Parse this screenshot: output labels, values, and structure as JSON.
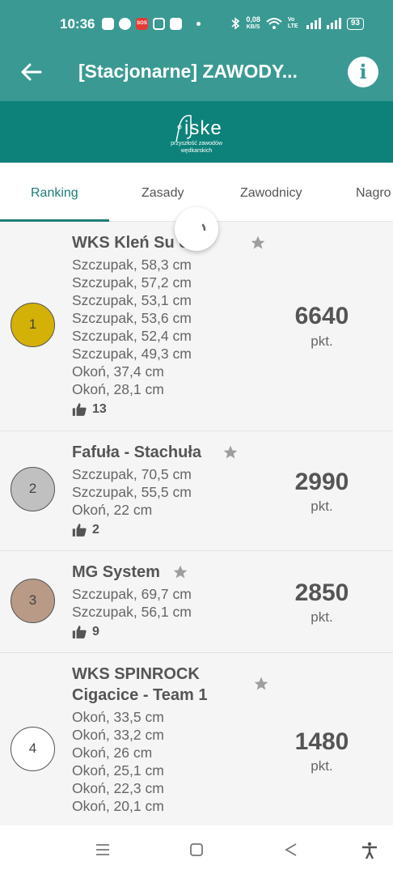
{
  "status_bar": {
    "time": "10:36",
    "net_speed_value": "0,08",
    "net_speed_unit": "KB/S",
    "volte": "Vo LTE",
    "battery": "93"
  },
  "header": {
    "title": "[Stacjonarne] ZAWODY..."
  },
  "brand": {
    "logo_name": "iske",
    "tagline_line1": "przyszłość zawodów",
    "tagline_line2": "wędkarskich"
  },
  "tabs": [
    {
      "label": "Ranking",
      "active": true
    },
    {
      "label": "Zasady"
    },
    {
      "label": "Zawodnicy"
    },
    {
      "label": "Nagro"
    }
  ],
  "ranking": [
    {
      "rank": "1",
      "medal_color": "#d4b106",
      "team": "WKS Kleń Su         ów",
      "catches": [
        "Szczupak, 58,3 cm",
        "Szczupak, 57,2 cm",
        "Szczupak, 53,1 cm",
        "Szczupak, 53,6 cm",
        "Szczupak, 52,4 cm",
        "Szczupak, 49,3 cm",
        "Okoń, 37,4 cm",
        "Okoń, 28,1 cm"
      ],
      "likes": "13",
      "points": "6640",
      "points_unit": "pkt."
    },
    {
      "rank": "2",
      "medal_color": "#c0c0c0",
      "team": "Fafuła - Stachuła",
      "catches": [
        "Szczupak, 70,5 cm",
        "Szczupak, 55,5 cm",
        "Okoń, 22 cm"
      ],
      "likes": "2",
      "points": "2990",
      "points_unit": "pkt."
    },
    {
      "rank": "3",
      "medal_color": "#b89a86",
      "team": "MG System",
      "catches": [
        "Szczupak, 69,7 cm",
        "Szczupak, 56,1 cm"
      ],
      "likes": "9",
      "points": "2850",
      "points_unit": "pkt."
    },
    {
      "rank": "4",
      "medal_color": "#ffffff",
      "team_line1": " WKS SPINROCK",
      "team_line2": "Cigacice - Team 1",
      "catches": [
        "Okoń, 33,5 cm",
        "Okoń, 33,2 cm",
        "Okoń, 26 cm",
        "Okoń, 25,1 cm",
        "Okoń, 22,3 cm",
        "Okoń, 20,1 cm"
      ],
      "points": "1480",
      "points_unit": "pkt."
    }
  ],
  "colors": {
    "primary": "#3a9a93",
    "brand_band": "#0d827a",
    "active_tab": "#1d7d77"
  }
}
